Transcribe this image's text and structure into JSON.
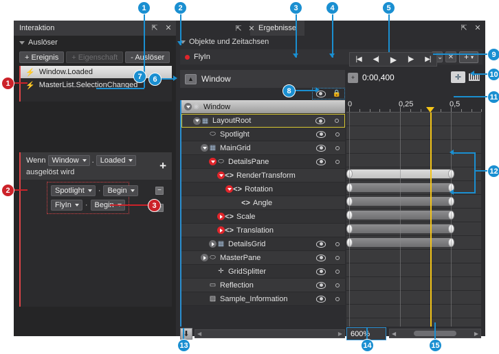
{
  "left_panel": {
    "title": "Interaktion",
    "window_buttons": [
      "float-icon",
      "close-icon"
    ],
    "section": {
      "label": "Auslöser",
      "expander": "caret-down-icon"
    },
    "buttons": [
      {
        "label": "+ Ereignis",
        "enabled": true
      },
      {
        "label": "+ Eigenschaft",
        "enabled": false
      },
      {
        "label": "- Auslöser",
        "enabled": true
      }
    ],
    "triggers": [
      {
        "label": "Window.Loaded",
        "selected": true,
        "icon": "lightning-icon"
      },
      {
        "label": "MasterList.SelectionChanged",
        "selected": false,
        "icon": "lightning-icon"
      }
    ],
    "condition": {
      "prefix": "Wenn",
      "object": "Window",
      "separator": ".",
      "event": "Loaded",
      "suffix": "ausgelöst wird",
      "add_label": "+",
      "actions": [
        {
          "target": "Spotlight",
          "sep": "·",
          "verb": "Begin",
          "remove": "−"
        },
        {
          "target": "FlyIn",
          "sep": "·",
          "verb": "Begin",
          "remove": "−"
        }
      ]
    }
  },
  "right_panel": {
    "tab": "Ergebnisse",
    "window_buttons": [
      "float-icon",
      "close-icon"
    ],
    "section_label": "Objekte und Zeitachsen",
    "storyboard": {
      "name": "FlyIn",
      "recording": true,
      "close_label": "✕",
      "collapse_label": "⌄⌄",
      "add_label": "+",
      "add_caret": "▾"
    },
    "playback": [
      "first-frame-icon",
      "prev-frame-icon",
      "play-icon",
      "next-frame-icon",
      "last-frame-icon"
    ],
    "root_row": {
      "label": "Window",
      "icon": "window-icon"
    },
    "time_field": {
      "value": "0:00,400",
      "icon": "record-keyframe-icon"
    },
    "tools": [
      "pan-tool-icon",
      "snap-ruler-icon"
    ],
    "column_headers": {
      "visibility": "eye-icon",
      "lock": "lock-icon"
    },
    "tree": [
      {
        "label": "Window",
        "indent": 0,
        "expander": "down",
        "red": false,
        "icon": "eye-icon",
        "header": true,
        "eye": false,
        "lock": false
      },
      {
        "label": "LayoutRoot",
        "indent": 1,
        "expander": "down",
        "red": false,
        "icon": "grid-icon",
        "selected": true,
        "eye": true,
        "lock": true
      },
      {
        "label": "Spotlight",
        "indent": 2,
        "expander": "none",
        "red": false,
        "icon": "ellipse-icon",
        "eye": true,
        "lock": true
      },
      {
        "label": "MainGrid",
        "indent": 2,
        "expander": "down",
        "red": false,
        "icon": "grid-icon",
        "eye": true,
        "lock": true
      },
      {
        "label": "DetailsPane",
        "indent": 3,
        "expander": "down",
        "red": true,
        "icon": "ellipse-icon",
        "eye": true,
        "lock": true
      },
      {
        "label": "RenderTransform",
        "indent": 4,
        "expander": "down",
        "red": true,
        "icon": "code-icon",
        "eye": false,
        "lock": false
      },
      {
        "label": "Rotation",
        "indent": 5,
        "expander": "down",
        "red": true,
        "icon": "code-icon",
        "eye": false,
        "lock": false
      },
      {
        "label": "Angle",
        "indent": 6,
        "expander": "none",
        "red": false,
        "icon": "code-icon",
        "eye": false,
        "lock": false
      },
      {
        "label": "Scale",
        "indent": 4,
        "expander": "right",
        "red": true,
        "icon": "code-icon",
        "eye": false,
        "lock": false
      },
      {
        "label": "Translation",
        "indent": 4,
        "expander": "right",
        "red": true,
        "icon": "code-icon",
        "eye": false,
        "lock": false
      },
      {
        "label": "DetailsGrid",
        "indent": 3,
        "expander": "right",
        "red": false,
        "icon": "grid-icon",
        "eye": true,
        "lock": true
      },
      {
        "label": "MasterPane",
        "indent": 2,
        "expander": "right",
        "red": false,
        "icon": "ellipse-icon",
        "eye": true,
        "lock": true
      },
      {
        "label": "GridSplitter",
        "indent": 3,
        "expander": "none",
        "red": false,
        "icon": "splitter-icon",
        "eye": true,
        "lock": true
      },
      {
        "label": "Reflection",
        "indent": 2,
        "expander": "none",
        "red": false,
        "icon": "rect-icon",
        "eye": true,
        "lock": true
      },
      {
        "label": "Sample_Information",
        "indent": 2,
        "expander": "none",
        "red": false,
        "icon": "image-icon",
        "eye": true,
        "lock": true
      }
    ],
    "ruler": {
      "labels": [
        "0",
        "0,25",
        "0,5"
      ],
      "unit": "s",
      "playhead_time": 0.4
    },
    "tracks": [
      {
        "row": 0,
        "bar": false
      },
      {
        "row": 1,
        "bar": false
      },
      {
        "row": 2,
        "bar": false
      },
      {
        "row": 3,
        "bar": false
      },
      {
        "row": 4,
        "bar": true,
        "style": "light",
        "start": 0,
        "end": 0.5
      },
      {
        "row": 5,
        "bar": true,
        "style": "dark",
        "start": 0,
        "end": 0.5
      },
      {
        "row": 6,
        "bar": true,
        "style": "dark",
        "start": 0,
        "end": 0.5
      },
      {
        "row": 7,
        "bar": true,
        "style": "dark",
        "start": 0,
        "end": 0.5
      },
      {
        "row": 8,
        "bar": true,
        "style": "dark",
        "start": 0,
        "end": 0.5
      },
      {
        "row": 9,
        "bar": true,
        "style": "dark",
        "start": 0,
        "end": 0.5
      },
      {
        "row": 10,
        "bar": false
      },
      {
        "row": 11,
        "bar": false
      },
      {
        "row": 12,
        "bar": false
      },
      {
        "row": 13,
        "bar": false
      },
      {
        "row": 14,
        "bar": false
      }
    ],
    "bottom": {
      "down_icon": "arrow-down-icon",
      "zoom_value": "600%",
      "scroll_left": "◀",
      "scroll_right": "▶"
    }
  },
  "callouts": {
    "blue": [
      {
        "n": "1"
      },
      {
        "n": "2"
      },
      {
        "n": "3"
      },
      {
        "n": "4"
      },
      {
        "n": "5"
      },
      {
        "n": "6"
      },
      {
        "n": "7"
      },
      {
        "n": "8"
      },
      {
        "n": "9"
      },
      {
        "n": "10"
      },
      {
        "n": "11"
      },
      {
        "n": "12"
      },
      {
        "n": "13"
      },
      {
        "n": "14"
      },
      {
        "n": "15"
      }
    ],
    "red": [
      {
        "n": "1"
      },
      {
        "n": "2"
      },
      {
        "n": "3"
      }
    ]
  }
}
